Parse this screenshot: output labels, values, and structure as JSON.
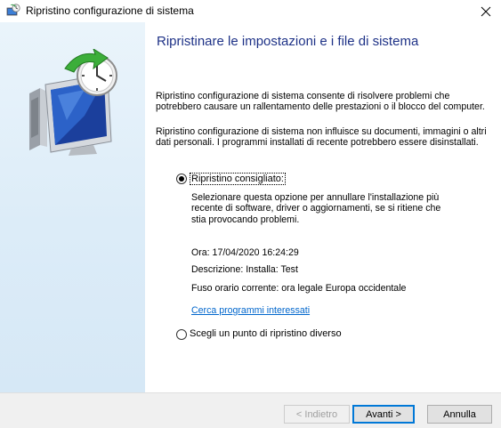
{
  "window": {
    "title": "Ripristino configurazione di sistema"
  },
  "main": {
    "heading": "Ripristinare le impostazioni e i file di sistema",
    "paragraph1": "Ripristino configurazione di sistema consente di risolvere problemi che potrebbero causare un rallentamento delle prestazioni o il blocco del computer.",
    "paragraph2": "Ripristino configurazione di sistema non influisce su documenti, immagini o altri dati personali. I programmi installati di recente potrebbero essere disinstallati.",
    "option_recommended": {
      "label": "Ripristino consigliato:",
      "selected": true,
      "description": "Selezionare questa opzione per annullare l'installazione più recente di software, driver o aggiornamenti, se si ritiene che stia provocando problemi.",
      "time": "Ora: 17/04/2020 16:24:29",
      "description_line": "Descrizione: Installa: Test",
      "timezone": "Fuso orario corrente: ora legale Europa occidentale",
      "link": "Cerca programmi interessati"
    },
    "option_other": {
      "label": "Scegli un punto di ripristino diverso",
      "selected": false
    }
  },
  "footer": {
    "back_label": "< Indietro",
    "next_label": "Avanti >",
    "cancel_label": "Annulla"
  },
  "icons": {
    "title": "system-restore-icon",
    "close": "close-icon",
    "hero": "system-restore-hero-icon"
  },
  "colors": {
    "heading": "#1e3287",
    "link": "#0066cc",
    "accent": "#0078d7"
  }
}
